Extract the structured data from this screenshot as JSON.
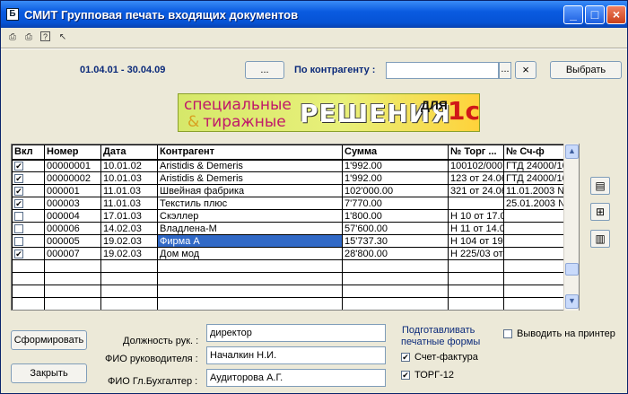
{
  "window": {
    "title": "СМИТ  Групповая печать входящих документов",
    "icon": "app-icon"
  },
  "toolbar": {
    "icons": [
      "group-print-icon",
      "group-print-alt-icon",
      "help-icon",
      "pointer-help-icon"
    ]
  },
  "filter": {
    "period": "01.04.01 - 30.04.09",
    "period_button": "...",
    "counterparty_label": "По контрагенту :",
    "counterparty_value": "",
    "counterparty_browse": "...",
    "counterparty_clear": "×",
    "select_button": "Выбрать"
  },
  "banner": {
    "line1": "специальные",
    "amp": "&",
    "line2": "тиражные",
    "main": "РЕШЕНИЯ",
    "for": "ДЛЯ",
    "brand": "1с"
  },
  "table": {
    "columns": [
      "Вкл",
      "Номер",
      "Дата",
      "Контрагент",
      "Сумма",
      "№ Торг ...",
      "№ Сч-ф"
    ],
    "rows": [
      {
        "checked": true,
        "number": "00000001",
        "date": "10.01.02",
        "kontragent": "Aristidis & Demeris",
        "sum": "1'992.00",
        "torg": "100102/0001",
        "schf": "ГТД 24000/10"
      },
      {
        "checked": true,
        "number": "00000002",
        "date": "10.01.03",
        "kontragent": "Aristidis & Demeris",
        "sum": "1'992.00",
        "torg": "123 от 24.06",
        "schf": "ГТД 24000/10"
      },
      {
        "checked": true,
        "number": "000001",
        "date": "11.01.03",
        "kontragent": "Швейная фабрика",
        "sum": "102'000.00",
        "torg": "321 от 24.06",
        "schf": "11.01.2003 №"
      },
      {
        "checked": true,
        "number": "000003",
        "date": "11.01.03",
        "kontragent": "Текстиль плюс",
        "sum": "7'770.00",
        "torg": "",
        "schf": "25.01.2003 №"
      },
      {
        "checked": false,
        "number": "000004",
        "date": "17.01.03",
        "kontragent": "Скэллер",
        "sum": "1'800.00",
        "torg": "Н 10 от 17.0",
        "schf": ""
      },
      {
        "checked": false,
        "number": "000006",
        "date": "14.02.03",
        "kontragent": "Владлена-М",
        "sum": "57'600.00",
        "torg": "Н 11 от 14.0",
        "schf": ""
      },
      {
        "checked": false,
        "number": "000005",
        "date": "19.02.03",
        "kontragent": "Фирма А",
        "sum": "15'737.30",
        "torg": "Н 104 от 19.",
        "schf": ""
      },
      {
        "checked": true,
        "number": "000007",
        "date": "19.02.03",
        "kontragent": "Дом мод",
        "sum": "28'800.00",
        "torg": "Н 225/03 от",
        "schf": ""
      }
    ],
    "empty_rows": 5,
    "selected_row": 6
  },
  "side_buttons": [
    "properties-icon",
    "columns-icon",
    "settings-icon"
  ],
  "footer": {
    "form_button": "Сформировать",
    "close_button": "Закрыть",
    "position_label": "Должность рук. :",
    "position_value": "директор",
    "head_label": "ФИО руководителя :",
    "head_value": "Началкин Н.И.",
    "accountant_label": "ФИО Гл.Бухгалтер :",
    "accountant_value": "Аудиторова А.Г.",
    "prepare_label_1": "Подготавливать",
    "prepare_label_2": "печатные формы",
    "invoice_label": "Счет-фактура",
    "invoice_checked": true,
    "torg12_label": "ТОРГ-12",
    "torg12_checked": true,
    "printer_label": "Выводить на принтер",
    "printer_checked": false
  },
  "colors": {
    "title": "#0653d5",
    "selection": "#3169c6",
    "label_blue": "#0b2a7a",
    "window_bg": "#ece9d8"
  }
}
